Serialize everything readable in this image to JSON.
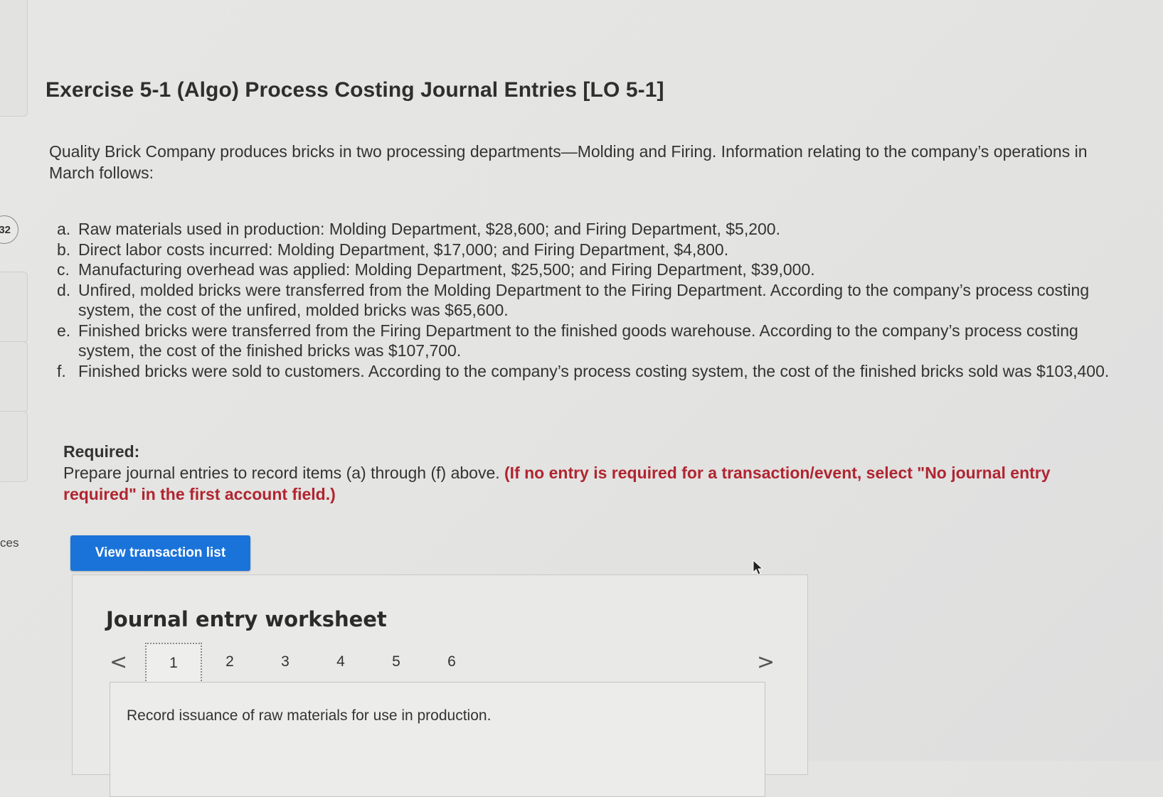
{
  "left_rail": {
    "badge": "32",
    "label": "ces"
  },
  "exercise": {
    "title": "Exercise 5-1 (Algo) Process Costing Journal Entries [LO 5-1]",
    "intro": "Quality Brick Company produces bricks in two processing departments—Molding and Firing. Information relating to the company’s operations in March follows:",
    "items": [
      {
        "marker": "a.",
        "text": "Raw materials used in production: Molding Department, $28,600; and Firing Department, $5,200."
      },
      {
        "marker": "b.",
        "text": "Direct labor costs incurred: Molding Department, $17,000; and Firing Department, $4,800."
      },
      {
        "marker": "c.",
        "text": "Manufacturing overhead was applied: Molding Department, $25,500; and Firing Department, $39,000."
      },
      {
        "marker": "d.",
        "text": "Unfired, molded bricks were transferred from the Molding Department to the Firing Department. According to the company’s process costing system, the cost of the unfired, molded bricks was $65,600."
      },
      {
        "marker": "e.",
        "text": "Finished bricks were transferred from the Firing Department to the finished goods warehouse. According to the company’s process costing system, the cost of the finished bricks was $107,700."
      },
      {
        "marker": "f.",
        "text": "Finished bricks were sold to customers. According to the company’s process costing system, the cost of the finished bricks sold was $103,400."
      }
    ]
  },
  "required": {
    "heading": "Required:",
    "text": "Prepare journal entries to record items (a) through (f) above.",
    "note": "(If no entry is required for a transaction/event, select \"No journal entry required\" in the first account field.)"
  },
  "view_button": {
    "label": "View transaction list"
  },
  "worksheet": {
    "title": "Journal entry worksheet",
    "pages": [
      "1",
      "2",
      "3",
      "4",
      "5",
      "6"
    ],
    "active_page": "1",
    "prev_arrow": "<",
    "next_arrow": ">",
    "entry_description": "Record issuance of raw materials for use in production."
  }
}
